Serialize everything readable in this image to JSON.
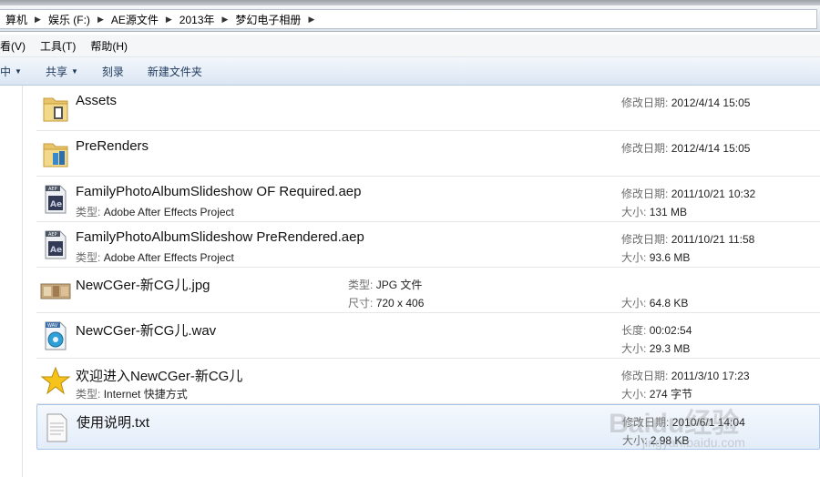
{
  "breadcrumbs": [
    "算机",
    "娱乐 (F:)",
    "AE源文件",
    "2013年",
    "梦幻电子相册"
  ],
  "menu": [
    "看(V)",
    "工具(T)",
    "帮助(H)"
  ],
  "toolbar": {
    "include": "中",
    "share": "共享",
    "burn": "刻录",
    "new_folder": "新建文件夹"
  },
  "files": [
    {
      "name": "Assets",
      "icon": "folder-icon",
      "meta1_label": "修改日期:",
      "meta1_value": "2012/4/14 15:05"
    },
    {
      "name": "PreRenders",
      "icon": "folder-icon",
      "meta1_label": "修改日期:",
      "meta1_value": "2012/4/14 15:05"
    },
    {
      "name": "FamilyPhotoAlbumSlideshow OF Required.aep",
      "icon": "aep-file-icon",
      "type_label": "类型:",
      "type_value": "Adobe After Effects Project",
      "meta1_label": "修改日期:",
      "meta1_value": "2011/10/21 10:32",
      "meta2_label": "大小:",
      "meta2_value": "131 MB"
    },
    {
      "name": "FamilyPhotoAlbumSlideshow PreRendered.aep",
      "icon": "aep-file-icon",
      "type_label": "类型:",
      "type_value": "Adobe After Effects Project",
      "meta1_label": "修改日期:",
      "meta1_value": "2011/10/21 11:58",
      "meta2_label": "大小:",
      "meta2_value": "93.6 MB"
    },
    {
      "name": "NewCGer-新CG儿.jpg",
      "icon": "jpg-thumbnail-icon",
      "mid1_label": "类型:",
      "mid1_value": "JPG 文件",
      "mid2_label": "尺寸:",
      "mid2_value": "720 x 406",
      "meta2_label": "大小:",
      "meta2_value": "64.8 KB"
    },
    {
      "name": "NewCGer-新CG儿.wav",
      "icon": "wav-file-icon",
      "meta1_label": "长度:",
      "meta1_value": "00:02:54",
      "meta2_label": "大小:",
      "meta2_value": "29.3 MB"
    },
    {
      "name": "欢迎进入NewCGer-新CG儿",
      "icon": "star-shortcut-icon",
      "type_label": "类型:",
      "type_value": "Internet 快捷方式",
      "meta1_label": "修改日期:",
      "meta1_value": "2011/3/10 17:23",
      "meta2_label": "大小:",
      "meta2_value": "274 字节"
    },
    {
      "name": "使用说明.txt",
      "icon": "txt-file-icon",
      "meta1_label": "修改日期:",
      "meta1_value": "2010/6/1 14:04",
      "meta2_label": "大小:",
      "meta2_value": "2.98 KB"
    }
  ],
  "watermark": {
    "main": "Baidu经验",
    "url": "jingyan.baidu.com"
  }
}
